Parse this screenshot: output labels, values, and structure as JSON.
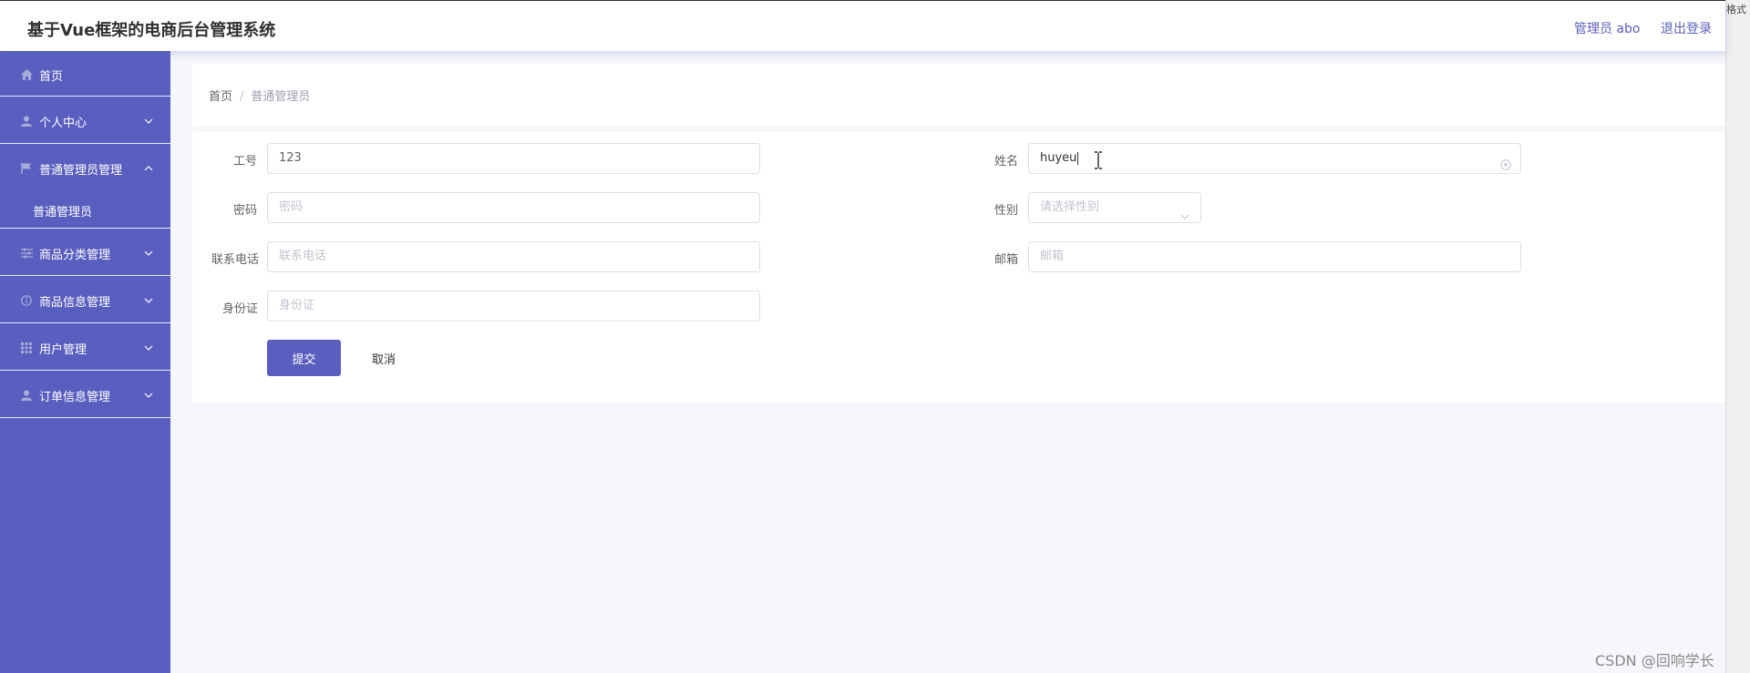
{
  "header": {
    "app_title": "基于Vue框架的电商后台管理系统",
    "admin_label": "管理员 abo",
    "logout_label": "退出登录"
  },
  "right_strip_text": "格式",
  "sidebar": {
    "items": [
      {
        "label": "首页",
        "icon": "home-icon",
        "expandable": false
      },
      {
        "label": "个人中心",
        "icon": "user-icon",
        "expandable": true
      },
      {
        "label": "普通管理员管理",
        "icon": "flag-icon",
        "expandable": true,
        "expanded": true
      },
      {
        "label": "商品分类管理",
        "icon": "sliders-icon",
        "expandable": true
      },
      {
        "label": "商品信息管理",
        "icon": "info-icon",
        "expandable": true
      },
      {
        "label": "用户管理",
        "icon": "grid-icon",
        "expandable": true
      },
      {
        "label": "订单信息管理",
        "icon": "user-icon",
        "expandable": true
      }
    ],
    "submenu": [
      {
        "label": "普通管理员",
        "active": true
      }
    ]
  },
  "breadcrumb": {
    "home": "首页",
    "separator": "/",
    "current": "普通管理员"
  },
  "form": {
    "job_no": {
      "label": "工号",
      "value": "123"
    },
    "name": {
      "label": "姓名",
      "value": "huyeu"
    },
    "password": {
      "label": "密码",
      "placeholder": "密码"
    },
    "gender": {
      "label": "性别",
      "placeholder": "请选择性别"
    },
    "phone": {
      "label": "联系电话",
      "placeholder": "联系电话"
    },
    "email": {
      "label": "邮箱",
      "placeholder": "邮箱"
    },
    "id_card": {
      "label": "身份证",
      "placeholder": "身份证"
    },
    "submit_label": "提交",
    "cancel_label": "取消"
  },
  "watermark": "CSDN @回响学长",
  "colors": {
    "sidebar_bg": "#5a5fbf",
    "primary": "#5a5fbf",
    "link": "#5a5fb8",
    "page_bg": "#f6f7fa"
  }
}
